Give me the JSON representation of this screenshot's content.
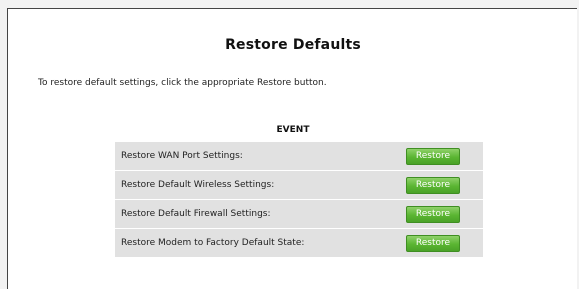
{
  "page": {
    "title": "Restore Defaults",
    "instructions": "To restore default settings, click the appropriate Restore button."
  },
  "table": {
    "header": "EVENT",
    "rows": [
      {
        "label": "Restore WAN Port Settings:",
        "button": "Restore"
      },
      {
        "label": "Restore Default Wireless Settings:",
        "button": "Restore"
      },
      {
        "label": "Restore Default Firewall Settings:",
        "button": "Restore"
      },
      {
        "label": "Restore Modem to Factory Default State:",
        "button": "Restore"
      }
    ]
  },
  "colors": {
    "button_green": "#5ab532",
    "row_background": "#e1e1e1"
  }
}
